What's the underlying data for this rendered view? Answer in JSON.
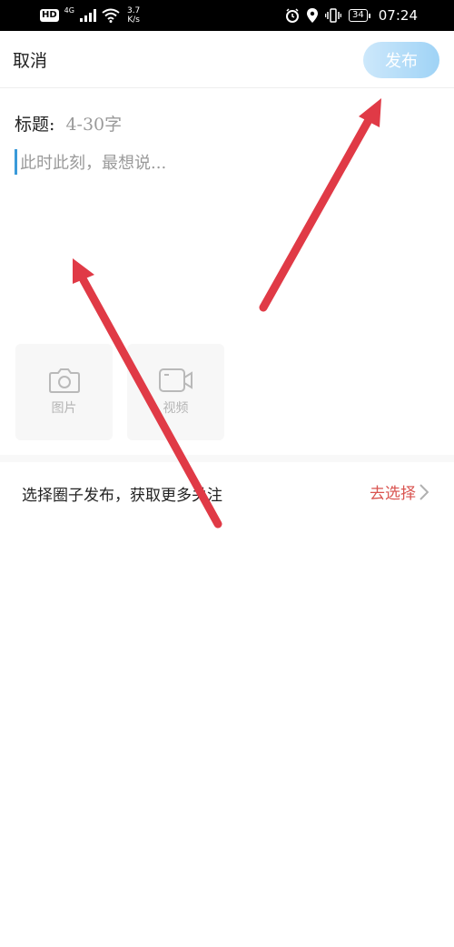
{
  "status_bar": {
    "hd": "HD",
    "network_type": "4G",
    "speed_value": "3.7",
    "speed_unit": "K/s",
    "battery": "34",
    "time": "07:24"
  },
  "header": {
    "cancel_label": "取消",
    "publish_label": "发布"
  },
  "editor": {
    "title_label": "标题:",
    "title_placeholder": "4-30字",
    "body_placeholder": "此时此刻，最想说..."
  },
  "media": {
    "photo_label": "图片",
    "video_label": "视频"
  },
  "circle": {
    "prompt": "选择圈子发布，获取更多关注",
    "choose_label": "去选择"
  },
  "colors": {
    "publish_button": "#a8d8f8",
    "choose_text": "#d9534f",
    "annotation_arrow": "#e03a46",
    "caret": "#3a9ad9"
  }
}
